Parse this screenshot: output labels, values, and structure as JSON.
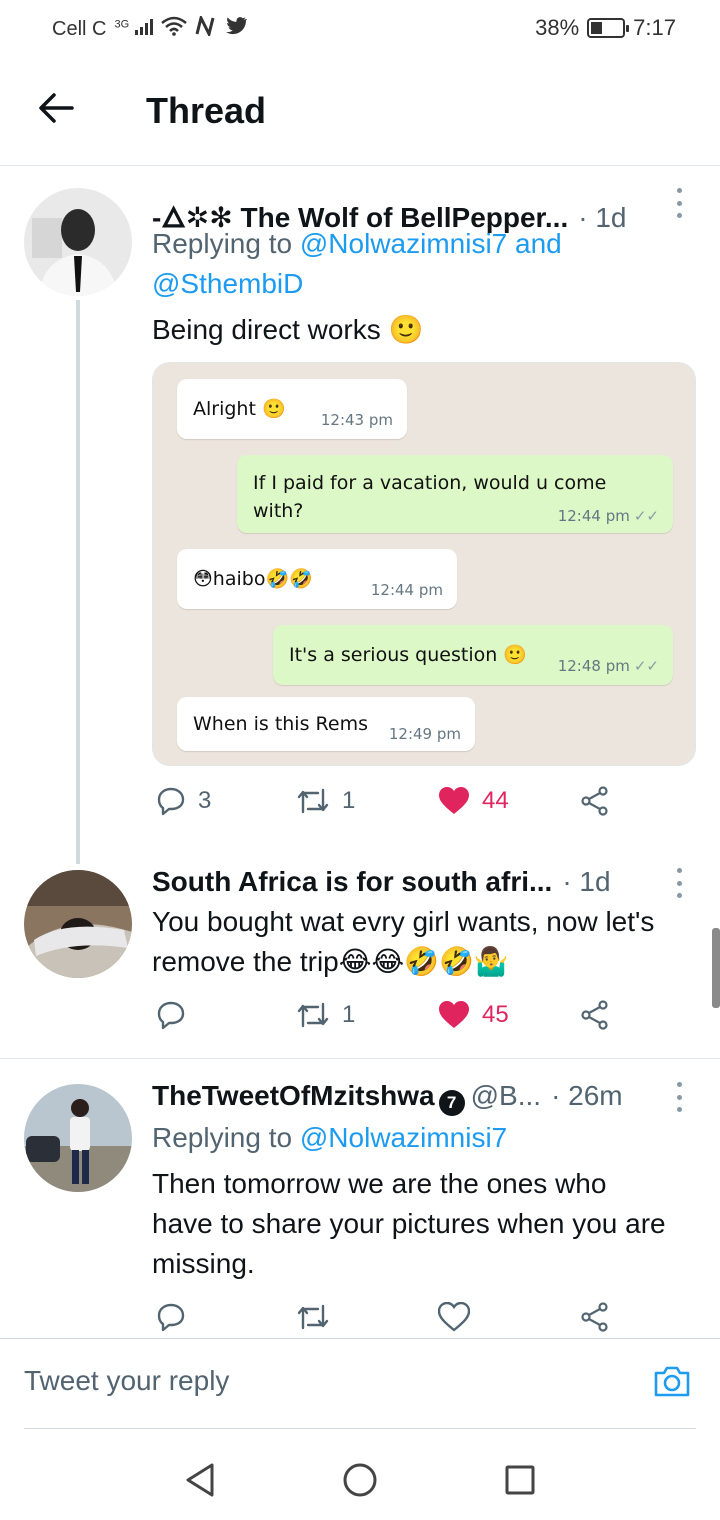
{
  "status_bar": {
    "carrier": "Cell C",
    "network": "3G",
    "battery": "38%",
    "battery_level": 0.38,
    "time": "7:17"
  },
  "header": {
    "back_icon": "arrow-left-icon",
    "title": "Thread"
  },
  "tweets": [
    {
      "display_name": "-🜂✲✻ The Wolf of BellPepper...",
      "time": "· 1d",
      "replying_prefix": "Replying to ",
      "replying_handles": "@Nolwazimnisi7 and @SthembiD",
      "text": "Being direct works 🙂",
      "replies": "3",
      "retweets": "1",
      "likes": "44",
      "liked": true
    },
    {
      "display_name": "South Africa is for south afri...",
      "time": "· 1d",
      "text": "You bought wat evry girl wants, now let's remove the trip😂😂🤣🤣🤷‍♂️",
      "replies": "",
      "retweets": "1",
      "likes": "45",
      "liked": true
    },
    {
      "display_name": "TheTweetOfMzitshwa",
      "badge": "7",
      "handle": "@B...",
      "time": "· 26m",
      "replying_prefix": "Replying to ",
      "replying_handles": "@Nolwazimnisi7",
      "text": "Then tomorrow we are the ones who have to share your pictures when you are missing.",
      "replies": "",
      "retweets": "",
      "likes": "",
      "liked": false
    }
  ],
  "media_chat": [
    {
      "dir": "in",
      "text": "Alright 🙂",
      "time": "12:43 pm"
    },
    {
      "dir": "out",
      "text": "If I paid for a vacation, would u come with?",
      "time": "12:44 pm"
    },
    {
      "dir": "in",
      "text": "😳haibo🤣🤣",
      "time": "12:44 pm"
    },
    {
      "dir": "out",
      "text": "It's a serious question 🙂",
      "time": "12:48 pm"
    },
    {
      "dir": "in",
      "text": "When is this Rems",
      "time": "12:49 pm"
    }
  ],
  "reply_bar": {
    "placeholder": "Tweet your reply",
    "camera_icon": "camera-icon"
  },
  "nav": {
    "back": "triangle-back-icon",
    "home": "circle-home-icon",
    "recents": "square-recents-icon"
  },
  "colors": {
    "link": "#1d9bf0",
    "like": "#e0245e",
    "muted": "#536471",
    "chat_out": "#dcf8c6",
    "chat_bg": "#ece5dd"
  }
}
